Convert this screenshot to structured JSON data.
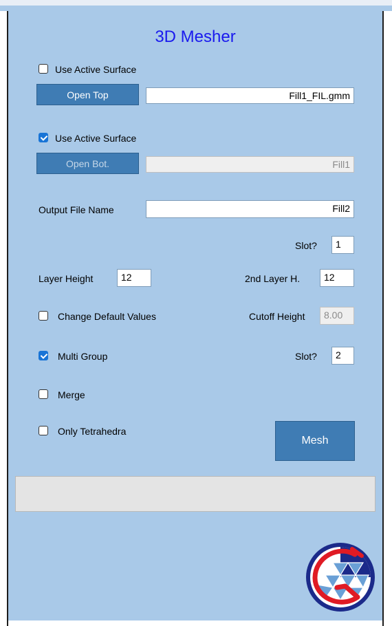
{
  "title": "3D Mesher",
  "top": {
    "use_active_surface_label": "Use Active Surface",
    "use_active_surface_checked": false,
    "open_button": "Open Top",
    "file_value": "Fill1_FIL.gmm"
  },
  "bottom": {
    "use_active_surface_label": "Use Active Surface",
    "use_active_surface_checked": true,
    "open_button": "Open Bot.",
    "file_value": "Fill1"
  },
  "output": {
    "label": "Output File Name",
    "value": "Fill2",
    "slot_label": "Slot?",
    "slot_value": "1"
  },
  "layers": {
    "layer_height_label": "Layer Height",
    "layer_height_value": "12",
    "second_layer_label": "2nd Layer H.",
    "second_layer_value": "12"
  },
  "defaults": {
    "change_default_label": "Change Default Values",
    "change_default_checked": false,
    "cutoff_label": "Cutoff Height",
    "cutoff_value": "8.00"
  },
  "multi_group": {
    "label": "Multi Group",
    "checked": true,
    "slot_label": "Slot?",
    "slot_value": "2"
  },
  "merge": {
    "label": "Merge",
    "checked": false
  },
  "only_tetra": {
    "label": "Only Tetrahedra",
    "checked": false
  },
  "mesh_button": "Mesh",
  "status_text": "",
  "colors": {
    "background": "#a9c9e8",
    "button": "#3f7cb4",
    "title": "#1a1aee",
    "checkbox_checked": "#1874d6"
  }
}
